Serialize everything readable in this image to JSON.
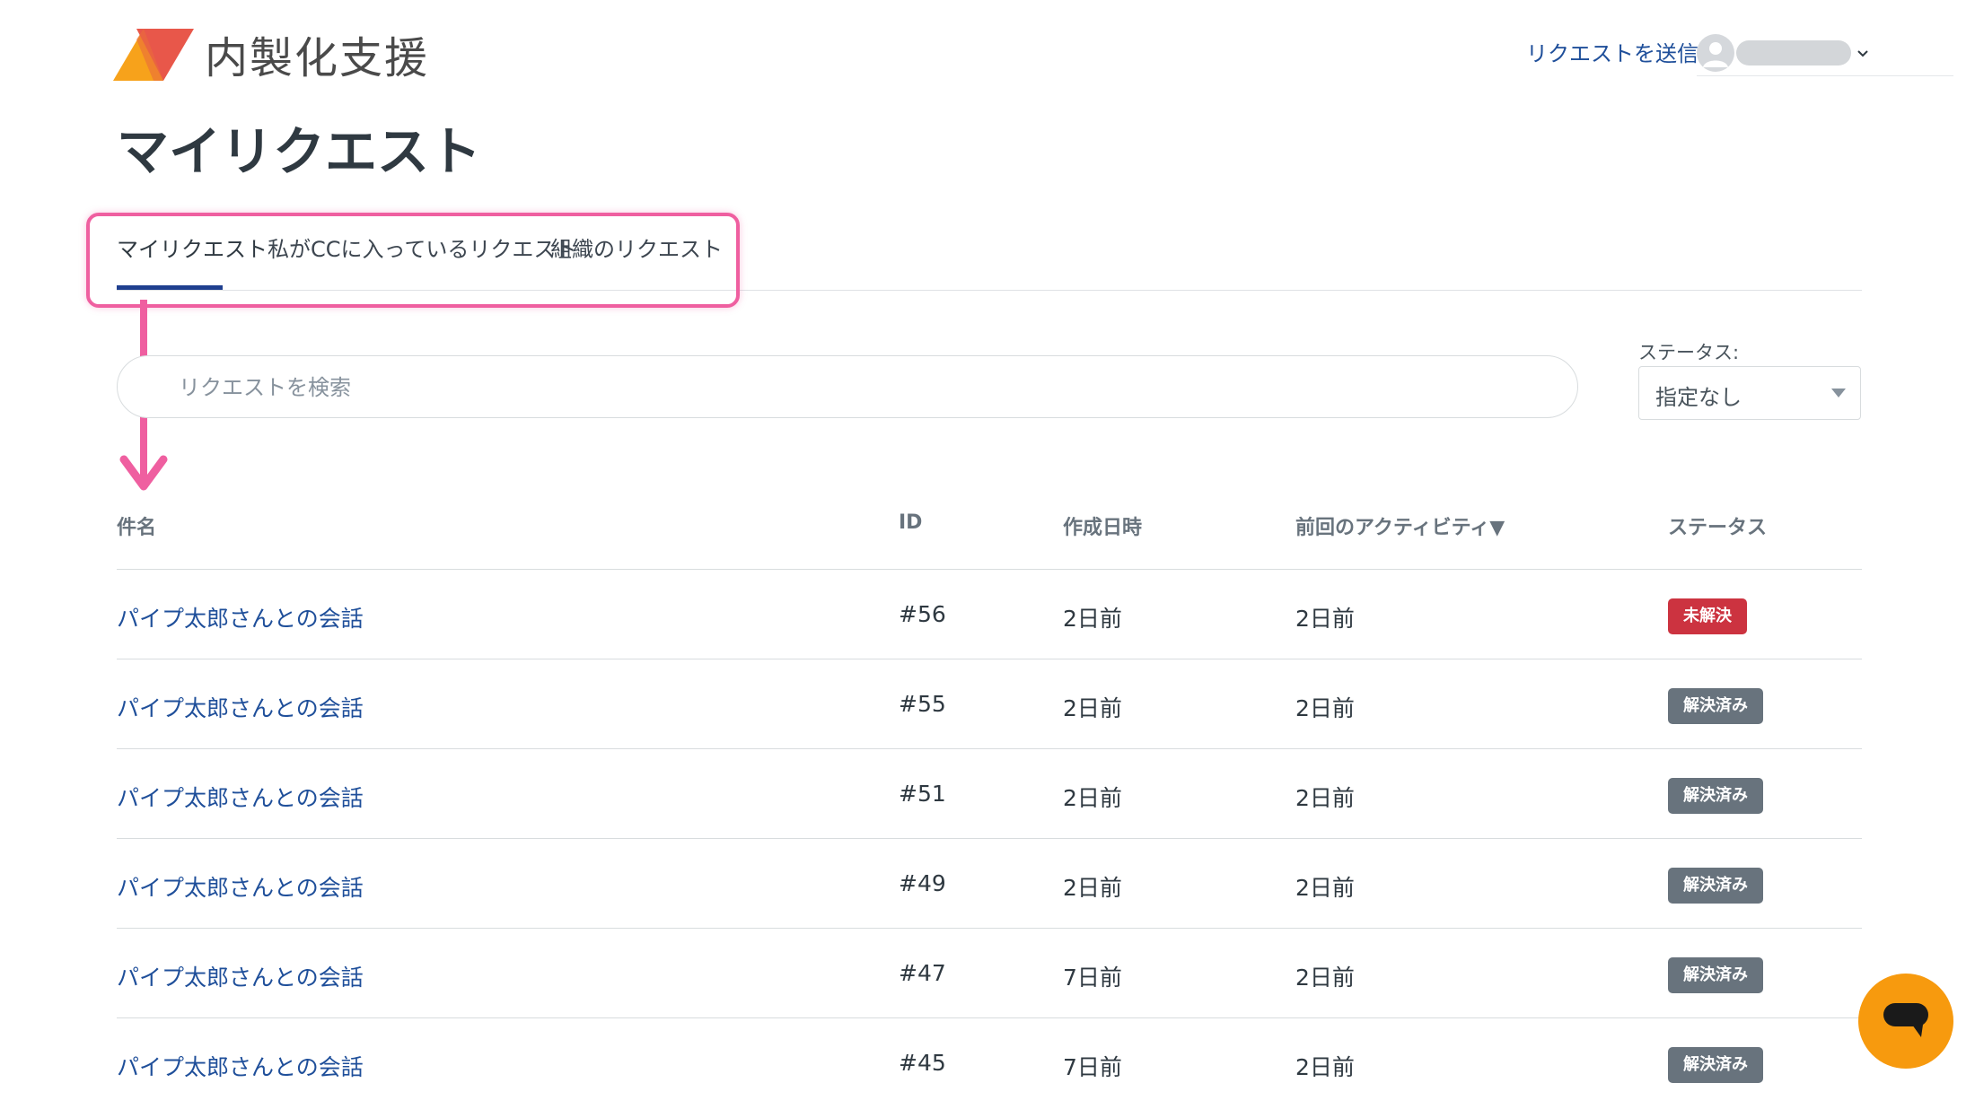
{
  "header": {
    "logo_text": "内製化支援",
    "submit_link": "リクエストを送信",
    "colors": {
      "logo_orange": "#f7a21b",
      "logo_red": "#e8574a"
    }
  },
  "page": {
    "title": "マイリクエスト"
  },
  "tabs": [
    {
      "label": "マイリクエスト",
      "active": true
    },
    {
      "label": "私がCCに入っているリクエスト",
      "active": false
    },
    {
      "label": "組織のリクエスト",
      "active": false
    }
  ],
  "search": {
    "placeholder": "リクエストを検索",
    "value": ""
  },
  "status_filter": {
    "label": "ステータス:",
    "selected": "指定なし"
  },
  "table": {
    "headers": {
      "subject": "件名",
      "id": "ID",
      "created": "作成日時",
      "last_activity": "前回のアクティビティ▼",
      "status": "ステータス"
    },
    "rows": [
      {
        "subject": "パイプ太郎さんとの会話",
        "id": "#56",
        "created": "2日前",
        "last_activity": "2日前",
        "status": "未解決",
        "status_color": "#cc3340"
      },
      {
        "subject": "パイプ太郎さんとの会話",
        "id": "#55",
        "created": "2日前",
        "last_activity": "2日前",
        "status": "解決済み",
        "status_color": "#68737d"
      },
      {
        "subject": "パイプ太郎さんとの会話",
        "id": "#51",
        "created": "2日前",
        "last_activity": "2日前",
        "status": "解決済み",
        "status_color": "#68737d"
      },
      {
        "subject": "パイプ太郎さんとの会話",
        "id": "#49",
        "created": "2日前",
        "last_activity": "2日前",
        "status": "解決済み",
        "status_color": "#68737d"
      },
      {
        "subject": "パイプ太郎さんとの会話",
        "id": "#47",
        "created": "7日前",
        "last_activity": "2日前",
        "status": "解決済み",
        "status_color": "#68737d"
      },
      {
        "subject": "パイプ太郎さんとの会話",
        "id": "#45",
        "created": "7日前",
        "last_activity": "2日前",
        "status": "解決済み",
        "status_color": "#68737d"
      }
    ]
  },
  "annotation": {
    "color": "#ef5fa0"
  },
  "chat": {
    "color": "#f79a0e",
    "icon": "chat-bubble-icon"
  }
}
